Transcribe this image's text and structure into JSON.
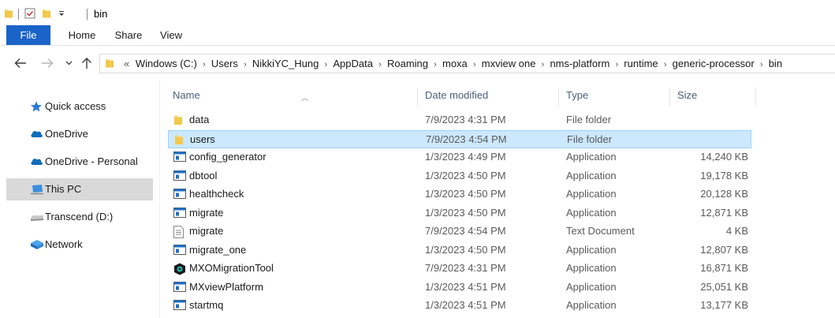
{
  "window": {
    "title": "bin"
  },
  "ribbon": {
    "tabs": [
      "File",
      "Home",
      "Share",
      "View"
    ]
  },
  "address": {
    "overflow": "«",
    "crumbs": [
      "Windows (C:)",
      "Users",
      "NikkiYC_Hung",
      "AppData",
      "Roaming",
      "moxa",
      "mxview one",
      "nms-platform",
      "runtime",
      "generic-processor",
      "bin"
    ]
  },
  "nav": {
    "items": [
      {
        "label": "Quick access",
        "icon": "star-icon"
      },
      {
        "label": "OneDrive",
        "icon": "cloud-icon"
      },
      {
        "label": "OneDrive - Personal",
        "icon": "cloud-icon"
      },
      {
        "label": "This PC",
        "icon": "computer-icon",
        "selected": true
      },
      {
        "label": "Transcend (D:)",
        "icon": "drive-icon"
      },
      {
        "label": "Network",
        "icon": "network-icon"
      }
    ]
  },
  "columns": {
    "name": "Name",
    "date": "Date modified",
    "type": "Type",
    "size": "Size"
  },
  "files": [
    {
      "name": "data",
      "date": "7/9/2023 4:31 PM",
      "type": "File folder",
      "size": "",
      "icon": "folder-icon"
    },
    {
      "name": "users",
      "date": "7/9/2023 4:54 PM",
      "type": "File folder",
      "size": "",
      "icon": "folder-icon",
      "selected": true
    },
    {
      "name": "config_generator",
      "date": "1/3/2023 4:49 PM",
      "type": "Application",
      "size": "14,240 KB",
      "icon": "application-icon"
    },
    {
      "name": "dbtool",
      "date": "1/3/2023 4:50 PM",
      "type": "Application",
      "size": "19,178 KB",
      "icon": "application-icon"
    },
    {
      "name": "healthcheck",
      "date": "1/3/2023 4:50 PM",
      "type": "Application",
      "size": "20,128 KB",
      "icon": "application-icon"
    },
    {
      "name": "migrate",
      "date": "1/3/2023 4:50 PM",
      "type": "Application",
      "size": "12,871 KB",
      "icon": "application-icon"
    },
    {
      "name": "migrate",
      "date": "7/9/2023 4:54 PM",
      "type": "Text Document",
      "size": "4 KB",
      "icon": "text-document-icon"
    },
    {
      "name": "migrate_one",
      "date": "1/3/2023 4:50 PM",
      "type": "Application",
      "size": "12,807 KB",
      "icon": "application-icon"
    },
    {
      "name": "MXOMigrationTool",
      "date": "7/9/2023 4:31 PM",
      "type": "Application",
      "size": "16,871 KB",
      "icon": "mxo-app-icon"
    },
    {
      "name": "MXviewPlatform",
      "date": "1/3/2023 4:51 PM",
      "type": "Application",
      "size": "25,051 KB",
      "icon": "application-icon"
    },
    {
      "name": "startmq",
      "date": "1/3/2023 4:51 PM",
      "type": "Application",
      "size": "13,177 KB",
      "icon": "application-icon"
    }
  ],
  "colors": {
    "accent": "#1a64c8",
    "selection": "#cce8ff",
    "folder": "#f8d775",
    "nav_selected": "#d9d9d9"
  }
}
